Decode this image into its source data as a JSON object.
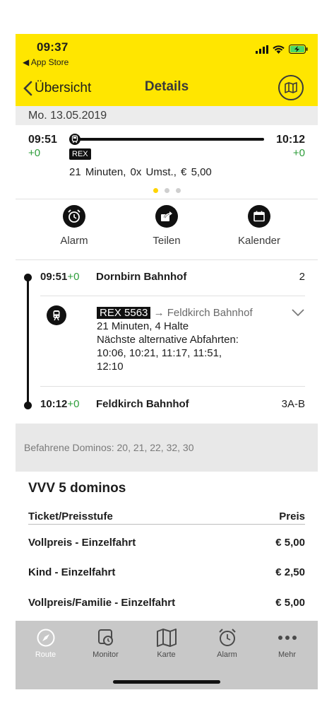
{
  "status": {
    "time": "09:37",
    "back_app": "◀ App Store"
  },
  "nav": {
    "back_label": "Übersicht",
    "title": "Details"
  },
  "date": "Mo. 13.05.2019",
  "summary": {
    "dep_time": "09:51",
    "dep_delay": "+0",
    "arr_time": "10:12",
    "arr_delay": "+0",
    "train_badge": "REX",
    "text": "21 Minuten, 0x Umst., € 5,00"
  },
  "actions": [
    {
      "label": "Alarm",
      "icon": "alarm-clock-icon"
    },
    {
      "label": "Teilen",
      "icon": "share-icon"
    },
    {
      "label": "Kalender",
      "icon": "calendar-icon"
    }
  ],
  "itinerary": {
    "origin": {
      "time": "09:51",
      "delay": "+0",
      "name": "Dornbirn Bahnhof",
      "platform": "2"
    },
    "leg": {
      "badge": "REX 5563",
      "direction": "→ Feldkirch Bahnhof",
      "duration": "21 Minuten, 4 Halte",
      "alt_title": "Nächste alternative Abfahrten:",
      "alt_times": "10:06, 10:21, 11:17, 11:51,",
      "alt_times_2": "12:10"
    },
    "destination": {
      "time": "10:12",
      "delay": "+0",
      "name": "Feldkirch Bahnhof",
      "platform": "3A-B"
    }
  },
  "dominos": "Befahrene Dominos: 20, 21, 22, 32, 30",
  "prices": {
    "title": "VVV 5 dominos",
    "col_ticket": "Ticket/Preisstufe",
    "col_price": "Preis",
    "rows": [
      {
        "ticket": "Vollpreis - Einzelfahrt",
        "price": "€ 5,00"
      },
      {
        "ticket": "Kind - Einzelfahrt",
        "price": "€ 2,50"
      },
      {
        "ticket": "Vollpreis/Familie - Einzelfahrt",
        "price": "€ 5,00"
      }
    ]
  },
  "tabs": [
    {
      "label": "Route",
      "icon": "compass-icon"
    },
    {
      "label": "Monitor",
      "icon": "monitor-clock-icon"
    },
    {
      "label": "Karte",
      "icon": "map-icon"
    },
    {
      "label": "Alarm",
      "icon": "alarm-clock-icon"
    },
    {
      "label": "Mehr",
      "icon": "more-dots-icon"
    }
  ],
  "colors": {
    "header": "#ffe600",
    "delay_green": "#2d9d3a",
    "pager_active": "#ffd400"
  }
}
